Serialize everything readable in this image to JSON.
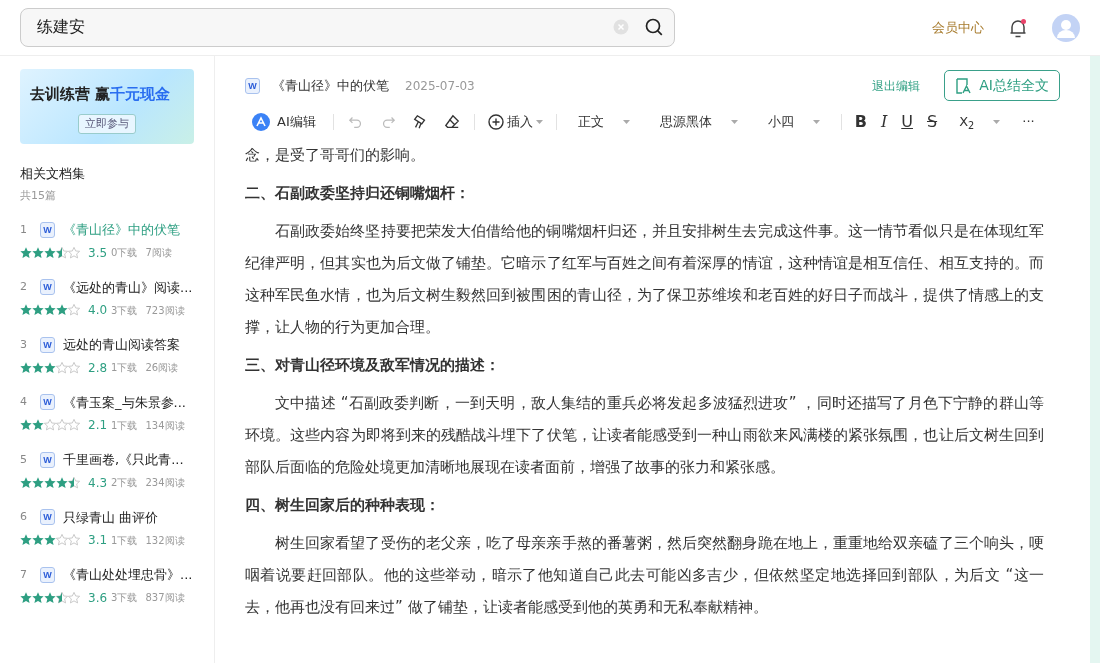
{
  "search": {
    "value": "练建安"
  },
  "header": {
    "member_link": "会员中心",
    "notification_dot": true
  },
  "sidebar": {
    "banner": {
      "title_part1": "去训练营",
      "title_part2": "赢",
      "title_highlight": "千元现金",
      "button": "立即参与"
    },
    "collection_title": "相关文档集",
    "collection_count": "共15篇",
    "items": [
      {
        "index": "1",
        "file_type": "W",
        "title": "《青山径》中的伏笔",
        "stars": 3.5,
        "rating": "3.5",
        "downloads": "0下载",
        "reads": "7阅读",
        "selected": true
      },
      {
        "index": "2",
        "file_type": "W",
        "title": "《远处的青山》阅读...",
        "stars": 4,
        "rating": "4.0",
        "downloads": "3下载",
        "reads": "723阅读",
        "selected": false
      },
      {
        "index": "3",
        "file_type": "W",
        "title": "远处的青山阅读答案",
        "stars": 3,
        "rating": "2.8",
        "downloads": "1下载",
        "reads": "26阅读",
        "selected": false
      },
      {
        "index": "4",
        "file_type": "W",
        "title": "《青玉案_与朱景参...",
        "stars": 2,
        "rating": "2.1",
        "downloads": "1下载",
        "reads": "134阅读",
        "selected": false
      },
      {
        "index": "5",
        "file_type": "W",
        "title": "千里画卷,《只此青...",
        "stars": 4.5,
        "rating": "4.3",
        "downloads": "2下载",
        "reads": "234阅读",
        "selected": false
      },
      {
        "index": "6",
        "file_type": "W",
        "title": "只绿青山 曲评价",
        "stars": 3,
        "rating": "3.1",
        "downloads": "1下载",
        "reads": "132阅读",
        "selected": false
      },
      {
        "index": "7",
        "file_type": "W",
        "title": "《青山处处埋忠骨》...",
        "stars": 3.5,
        "rating": "3.6",
        "downloads": "3下载",
        "reads": "837阅读",
        "selected": false
      }
    ]
  },
  "document": {
    "file_type": "W",
    "title": "《青山径》中的伏笔",
    "date": "2025-07-03",
    "exit_edit": "退出编辑",
    "ai_summary": "AI总结全文",
    "toolbar": [
      {
        "kind": "ai",
        "label": "AI编辑"
      },
      {
        "kind": "sep"
      },
      {
        "kind": "undo"
      },
      {
        "kind": "redo"
      },
      {
        "kind": "brush"
      },
      {
        "kind": "eraser"
      },
      {
        "kind": "sep"
      },
      {
        "kind": "insert",
        "label": "插入"
      },
      {
        "kind": "sep"
      },
      {
        "kind": "dropdown",
        "label": "正文"
      },
      {
        "kind": "dropdown",
        "label": "思源黑体"
      },
      {
        "kind": "dropdown",
        "label": "小四"
      },
      {
        "kind": "sep"
      },
      {
        "kind": "bold",
        "label": "B"
      },
      {
        "kind": "italic",
        "label": "I"
      },
      {
        "kind": "underline",
        "label": "U"
      },
      {
        "kind": "strike",
        "label": "S"
      },
      {
        "kind": "dropdown",
        "label": "X$_{2}$"
      },
      {
        "kind": "more",
        "label": "···"
      }
    ],
    "blocks": [
      {
        "kind": "continuation",
        "text": "念，是受了哥哥们的影响。"
      },
      {
        "kind": "heading",
        "text": "二、石副政委坚持归还铜嘴烟杆："
      },
      {
        "kind": "paragraph",
        "text": "石副政委始终坚持要把荣发大伯借给他的铜嘴烟杆归还，并且安排树生去完成这件事。这一情节看似只是在体现红军纪律严明，但其实也为后文做了铺垫。它暗示了红军与百姓之间有着深厚的情谊，这种情谊是相互信任、相互支持的。而这种军民鱼水情，也为后文树生毅然回到被围困的青山径，为了保卫苏维埃和老百姓的好日子而战斗，提供了情感上的支撑，让人物的行为更加合理。"
      },
      {
        "kind": "heading",
        "text": "三、对青山径环境及敌军情况的描述："
      },
      {
        "kind": "paragraph",
        "text": "文中描述 “石副政委判断，一到天明，敌人集结的重兵必将发起多波猛烈进攻” ，同时还描写了月色下宁静的群山等环境。这些内容为即将到来的残酷战斗埋下了伏笔，让读者能感受到一种山雨欲来风满楼的紧张氛围，也让后文树生回到部队后面临的危险处境更加清晰地展现在读者面前，增强了故事的张力和紧张感。"
      },
      {
        "kind": "heading",
        "text": "四、树生回家后的种种表现："
      },
      {
        "kind": "paragraph",
        "text": "树生回家看望了受伤的老父亲，吃了母亲亲手熬的番薯粥，然后突然翻身跪在地上，重重地给双亲磕了三个响头，哽咽着说要赶回部队。他的这些举动，暗示了他知道自己此去可能凶多吉少，但依然坚定地选择回到部队，为后文 “这一去，他再也没有回来过” 做了铺垫，让读者能感受到他的英勇和无私奉献精神。"
      }
    ]
  }
}
